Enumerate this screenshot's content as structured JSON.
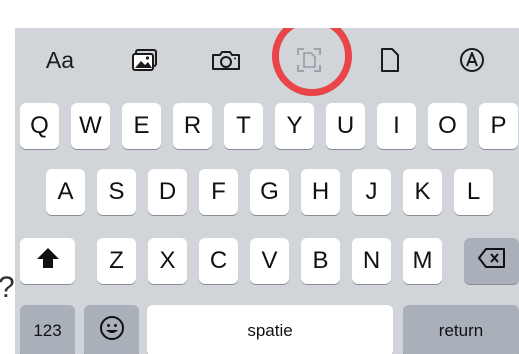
{
  "stray_char": "?",
  "toolbar": {
    "format_label": "Aa",
    "icons": [
      "photo-library-icon",
      "camera-icon",
      "scan-document-icon",
      "document-icon",
      "markup-pen-icon"
    ],
    "highlight_color": "#e94448"
  },
  "keyboard": {
    "row1": [
      "Q",
      "W",
      "E",
      "R",
      "T",
      "Y",
      "U",
      "I",
      "O",
      "P"
    ],
    "row2": [
      "A",
      "S",
      "D",
      "F",
      "G",
      "H",
      "J",
      "K",
      "L"
    ],
    "row3": [
      "Z",
      "X",
      "C",
      "V",
      "B",
      "N",
      "M"
    ],
    "numbers_label": "123",
    "space_label": "spatie",
    "return_label": "return",
    "icons": [
      "shift-icon",
      "delete-icon",
      "emoji-icon"
    ],
    "colors": {
      "background": "#d1d4d9",
      "key": "#ffffff",
      "function_key": "#aab0b9"
    }
  }
}
